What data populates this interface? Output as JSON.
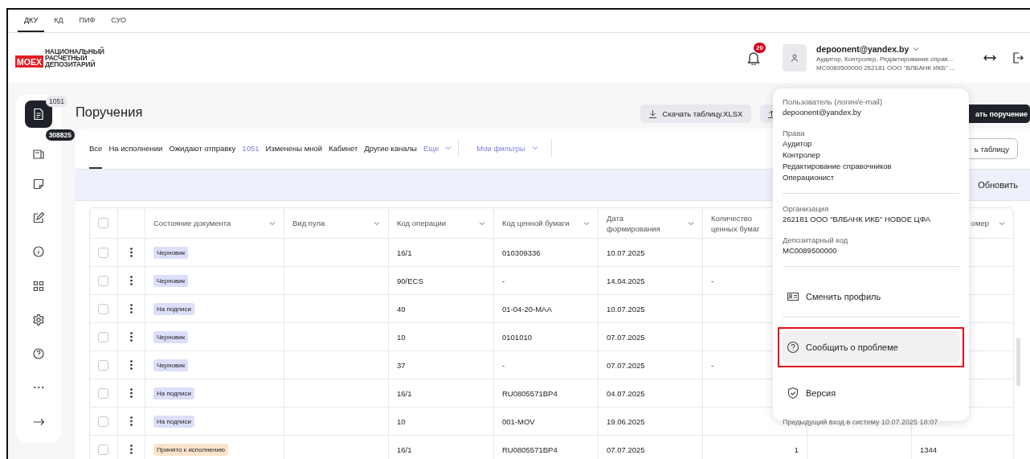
{
  "top_tabs": [
    {
      "label": "ДКУ",
      "selected": true
    },
    {
      "label": "КД",
      "selected": false
    },
    {
      "label": "ПИФ",
      "selected": false
    },
    {
      "label": "СУО",
      "selected": false
    }
  ],
  "logo": {
    "mark": "MOEX",
    "lines": [
      "НАЦИОНАЛЬНЫЙ",
      "РАСЧЕТНЫЙ",
      "ДЕПОЗИТАРИЙ"
    ]
  },
  "header": {
    "notifications": "20",
    "user": {
      "email": "depoonent@yandex.by",
      "roles": "Аудитор, Контролер, Редактирование справ...",
      "organization": "MC0089500000 262181 ООО \"ВЛБАНК ИКБ\" ..."
    }
  },
  "sidebar": {
    "items": [
      {
        "kind": "document",
        "selected": true,
        "badge": "1051"
      },
      {
        "kind": "card",
        "selected": false,
        "badge": "308825"
      },
      {
        "kind": "note",
        "selected": false
      },
      {
        "kind": "edit",
        "selected": false
      },
      {
        "kind": "info",
        "selected": false
      },
      {
        "kind": "grid",
        "selected": false
      },
      {
        "kind": "gear",
        "selected": false
      },
      {
        "kind": "help",
        "selected": false
      },
      {
        "kind": "more",
        "selected": false
      },
      {
        "kind": "arrow",
        "selected": false
      }
    ]
  },
  "page": {
    "title": "Поручения",
    "actions": [
      {
        "kind": "download",
        "label": "Скачать таблицу.XLSX"
      },
      {
        "kind": "upload"
      },
      {
        "kind": "primary",
        "label": "ать поручение"
      }
    ]
  },
  "filter_tabs": [
    {
      "label": "Все",
      "selected": true
    },
    {
      "label": "На исполнении",
      "selected": false
    },
    {
      "label": "Ожидают отправку",
      "count": "1051",
      "selected": false
    },
    {
      "label": "Изменены мной",
      "selected": false
    },
    {
      "label": "Кабинет",
      "selected": false
    },
    {
      "label": "Другие каналы",
      "selected": false
    }
  ],
  "more_tab": {
    "label": "Еще"
  },
  "my_filters": {
    "label": "Мои фильтры"
  },
  "table_button": {
    "label": "ь таблицу"
  },
  "refresh": {
    "label": "Обновить"
  },
  "table": {
    "select_all": {
      "checked": false
    },
    "columns": [
      {
        "label": "Состояние документа"
      },
      {
        "label": "Вид пула"
      },
      {
        "label": "Код операции"
      },
      {
        "label": "Код ценной бумаги"
      },
      {
        "label": "Дата формирования"
      },
      {
        "label": "Количество ценных бумаг"
      },
      {
        "label": "омер"
      }
    ],
    "rows": [
      {
        "checked": false,
        "status": {
          "label": "Черновик",
          "color": "#dcdefa"
        },
        "operation": "16/1",
        "security": "010309336",
        "date": "10.07.2025"
      },
      {
        "checked": false,
        "status": {
          "label": "Черновик",
          "color": "#dcdefa"
        },
        "operation": "90/ECS",
        "security": "-",
        "date": "14.04.2025",
        "quantity": {
          "kind": "empty",
          "value": "-"
        }
      },
      {
        "checked": false,
        "status": {
          "label": "На подписи",
          "color": "#dcdefa"
        },
        "operation": "40",
        "security": "01-04-20-MAA",
        "date": "10.07.2025"
      },
      {
        "checked": false,
        "status": {
          "label": "Черновик",
          "color": "#dcdefa"
        },
        "operation": "10",
        "security": "0101010",
        "date": "07.07.2025"
      },
      {
        "checked": false,
        "status": {
          "label": "Черновик",
          "color": "#dcdefa"
        },
        "operation": "37",
        "security": "-",
        "date": "07.07.2025",
        "quantity": {
          "kind": "empty",
          "value": "-"
        }
      },
      {
        "checked": false,
        "status": {
          "label": "На подписи",
          "color": "#dcdefa"
        },
        "operation": "16/1",
        "security": "RU0805571BP4",
        "date": "04.07.2025"
      },
      {
        "checked": false,
        "status": {
          "label": "На подписи",
          "color": "#dcdefa"
        },
        "operation": "10",
        "security": "001-MOV",
        "date": "19.06.2025"
      },
      {
        "checked": false,
        "status": {
          "label": "Принято к исполнению",
          "color": "#fde3cc"
        },
        "operation": "16/1",
        "security": "RU0805571BP4",
        "date": "07.07.2025",
        "quantity": {
          "kind": "number",
          "value": "1"
        },
        "number": "1344"
      }
    ]
  },
  "profile_menu": {
    "sections": [
      {
        "label": "Пользователь (логин/e-mail)",
        "values": [
          "depoonent@yandex.by"
        ]
      },
      {
        "label": "Права",
        "values": [
          "Аудитор",
          "Контролер",
          "Редактирование справочников",
          "Операционист"
        ]
      }
    ],
    "org_sections": [
      {
        "label": "Организация",
        "values": [
          "262181 ООО \"ВЛБАНК ИКБ\" НОВОЕ ЦФА"
        ]
      },
      {
        "label": "Депозитарный код",
        "values": [
          "MC0089500000"
        ]
      }
    ],
    "items": [
      {
        "kind": "profile",
        "label": "Сменить профиль",
        "highlighted": false
      },
      {
        "kind": "help",
        "label": "Сообщить о проблеме",
        "highlighted": true
      },
      {
        "kind": "shield",
        "label": "Версия",
        "highlighted": false
      }
    ],
    "footer": "Предыдущий вход в систему 10.07.2025 18:07"
  }
}
